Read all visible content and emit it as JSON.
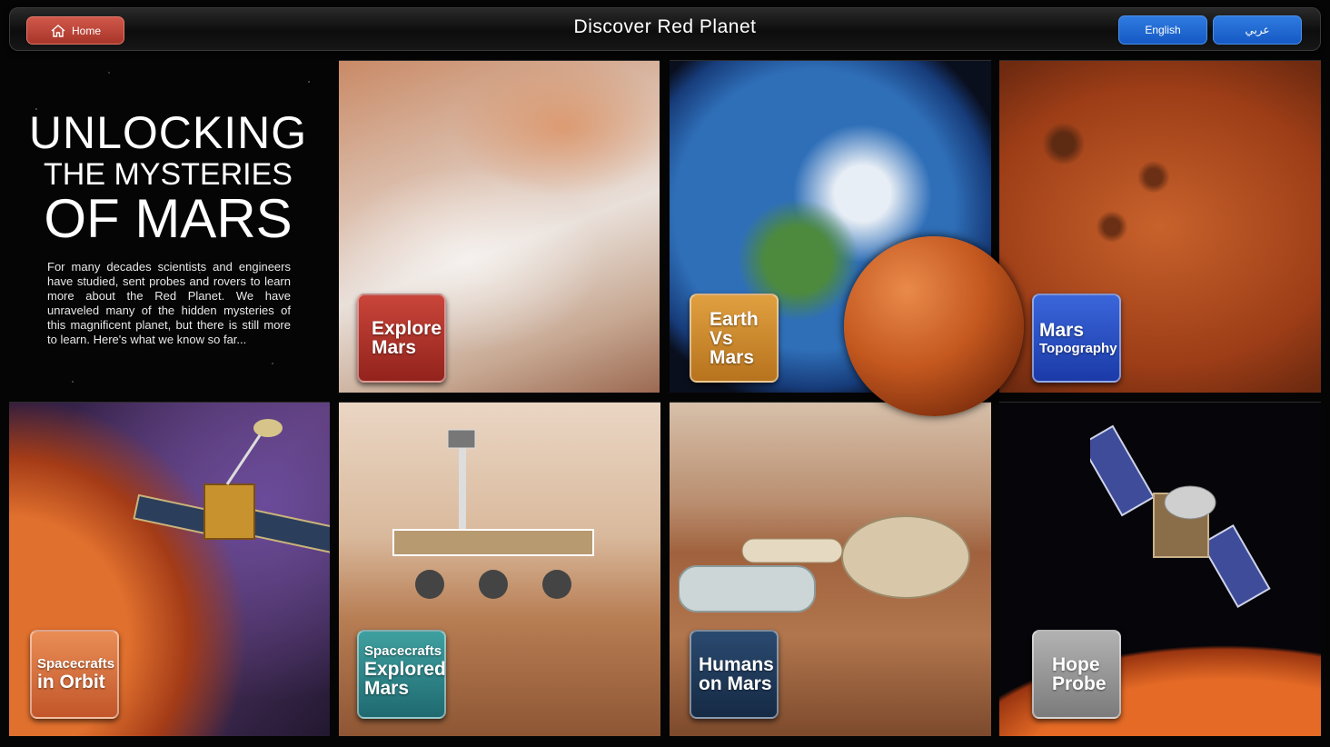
{
  "header": {
    "home_label": "Home",
    "title": "Discover Red Planet",
    "lang_en": "English",
    "lang_ar": "عربي"
  },
  "intro": {
    "line1": "UNLOCKING",
    "line2": "THE MYSTERIES",
    "line3": "OF MARS",
    "body": "For many decades scientists and engineers have studied, sent probes and rovers to learn more about the Red Planet. We have unraveled many of the hidden mysteries of this magnificent planet, but there is still more to learn. Here's what we know so far..."
  },
  "tiles": {
    "explore": {
      "l1": "Explore",
      "l2": "Mars"
    },
    "earth": {
      "l1": "Earth",
      "l2": "Vs",
      "l3": "Mars"
    },
    "topo": {
      "l1": "Mars",
      "sub": "Topography"
    },
    "orbit": {
      "sub": "Spacecrafts",
      "l1": "in Orbit"
    },
    "explored": {
      "sub": "Spacecrafts",
      "l1": "Explored",
      "l2": "Mars"
    },
    "humans": {
      "l1": "Humans",
      "l2": "on Mars"
    },
    "hope": {
      "l1": "Hope",
      "l2": "Probe"
    }
  },
  "colors": {
    "home": "#b8443a",
    "lang": "#1d66d1",
    "explore": "#b2342c",
    "earth": "#cf8a2e",
    "topo": "#2b4fc6",
    "orbit": "#d97440",
    "explored": "#2f8585",
    "humans": "#1f3958",
    "hope": "#999999"
  }
}
